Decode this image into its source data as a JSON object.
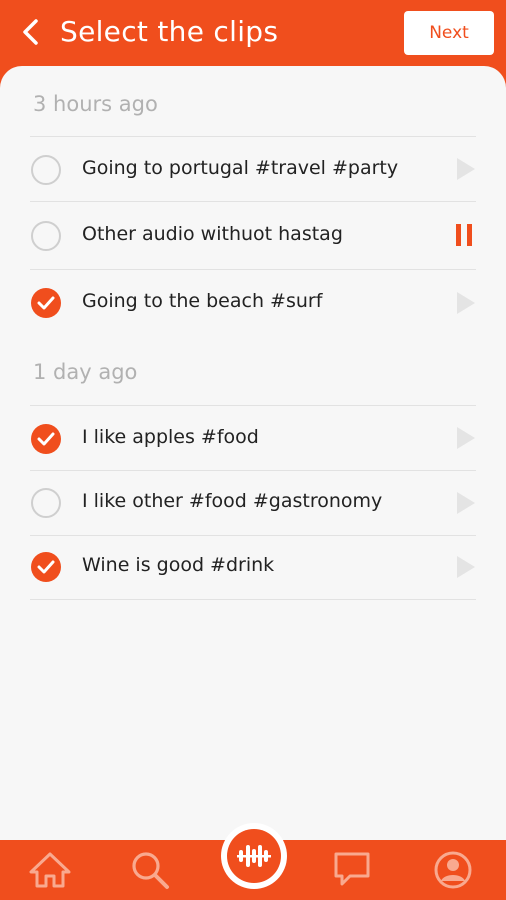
{
  "header": {
    "title": "Select the clips",
    "next_label": "Next"
  },
  "sections": [
    {
      "title": "3 hours ago",
      "items": [
        {
          "label": "Going to portugal #travel #party",
          "checked": false,
          "playing": false
        },
        {
          "label": "Other audio withuot hastag",
          "checked": false,
          "playing": true
        },
        {
          "label": "Going to the beach #surf",
          "checked": true,
          "playing": false
        }
      ]
    },
    {
      "title": "1 day ago",
      "items": [
        {
          "label": "I like apples #food",
          "checked": true,
          "playing": false
        },
        {
          "label": "I like other #food #gastronomy",
          "checked": false,
          "playing": false
        },
        {
          "label": "Wine is good #drink",
          "checked": true,
          "playing": false
        }
      ]
    }
  ],
  "tabbar": {
    "items": [
      {
        "icon": "home-icon"
      },
      {
        "icon": "search-icon"
      },
      {
        "icon": "waveform-icon"
      },
      {
        "icon": "chat-icon"
      },
      {
        "icon": "profile-icon"
      }
    ]
  },
  "colors": {
    "accent": "#f04e1d",
    "background": "#f7f7f7",
    "divider": "#e2e2e2",
    "muted_text": "#b1b1b1"
  }
}
